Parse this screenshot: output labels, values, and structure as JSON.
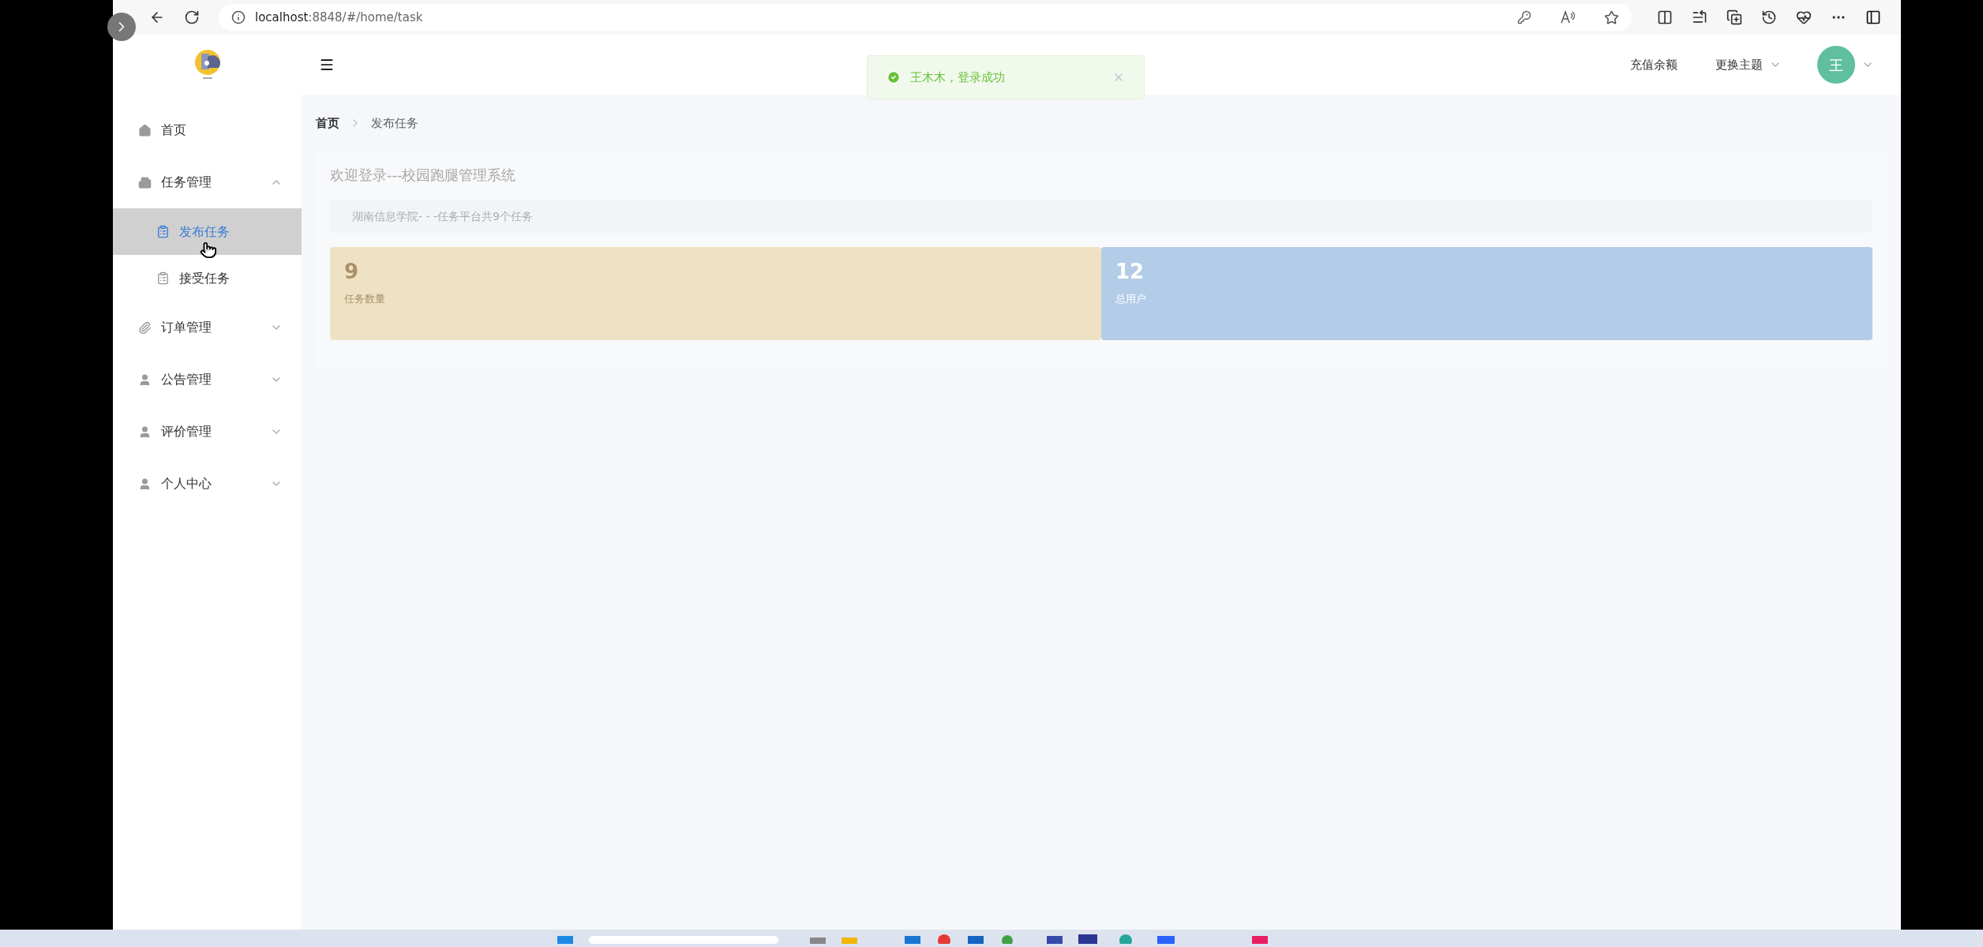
{
  "browser": {
    "url_host": "localhost",
    "url_rest": ":8848/#/home/task"
  },
  "toast": {
    "message": "王木木，登录成功"
  },
  "header": {
    "recharge": "充值余额",
    "theme_menu": "更换主题",
    "avatar": "王"
  },
  "sidebar": {
    "items": [
      {
        "label": "首页",
        "selected": false
      },
      {
        "label": "任务管理",
        "expanded": true,
        "children": [
          {
            "label": "发布任务",
            "selected": true
          },
          {
            "label": "接受任务",
            "selected": false
          }
        ]
      },
      {
        "label": "订单管理",
        "expanded": false
      },
      {
        "label": "公告管理",
        "expanded": false
      },
      {
        "label": "评价管理",
        "expanded": false
      },
      {
        "label": "个人中心",
        "expanded": false
      }
    ]
  },
  "breadcrumb": [
    {
      "label": "首页",
      "current": false
    },
    {
      "label": "发布任务",
      "current": true
    }
  ],
  "welcome": {
    "title": "欢迎登录---校园跑腿管理系统",
    "notice": "湖南信息学院- - -任务平台共9个任务"
  },
  "stats": [
    {
      "value": "9",
      "label": "任务数量",
      "color": "#efe2c4"
    },
    {
      "value": "12",
      "label": "总用户",
      "color": "#b3cde8"
    }
  ]
}
